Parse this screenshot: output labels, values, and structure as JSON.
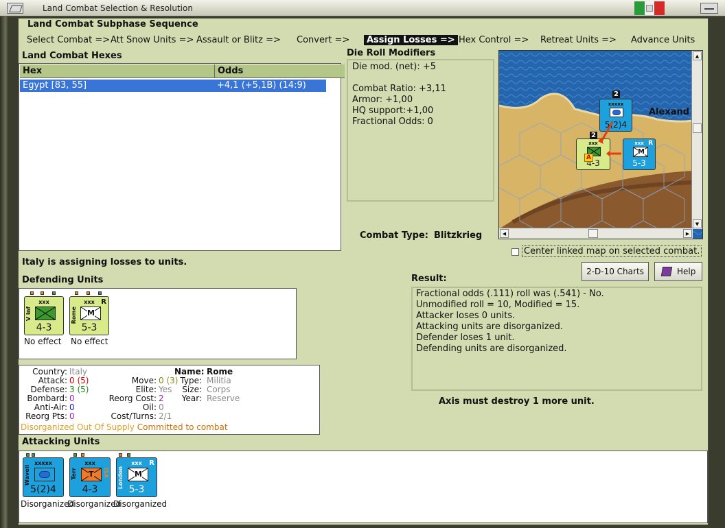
{
  "window": {
    "title": "Land Combat Selection & Resolution"
  },
  "sequence": {
    "header": "Land Combat Subphase Sequence",
    "steps": [
      "Select Combat =>",
      "Att Snow Units =>",
      "Assault or Blitz =>",
      "Convert =>",
      "Assign Losses =>",
      "Hex Control =>",
      "Retreat Units =>",
      "Advance Units"
    ],
    "active_index": 4
  },
  "hexes": {
    "header": "Land Combat Hexes",
    "columns": [
      "Hex",
      "Odds"
    ],
    "rows": [
      {
        "hex": "Egypt [83, 55]",
        "odds": "+4,1 (+5,1B) (14:9)"
      }
    ]
  },
  "modifiers": {
    "header": "Die Roll Modifiers",
    "lines": [
      "Die mod. (net): +5",
      "Combat Ratio: +3,11",
      "Armor: +1,00",
      "HQ support:+1,00",
      "Fractional Odds: 0"
    ]
  },
  "combat_type": {
    "label": "Combat Type:",
    "value": "Blitzkrieg"
  },
  "map": {
    "place_label": "Alexand",
    "center_linked_label": "Center linked map on selected combat.",
    "units": [
      {
        "name": "Wavell",
        "size": "xxxxx",
        "strength": "5(2)4",
        "stack": "2"
      },
      {
        "name": "V Inf",
        "size": "xxx",
        "strength": "4-3",
        "stack": "2",
        "badge": "A"
      },
      {
        "name": "London",
        "size": "xxx",
        "strength": "5-3",
        "type": "M",
        "corner": "R"
      }
    ]
  },
  "status": "Italy is assigning losses to units.",
  "buttons": {
    "charts": "2-D-10 Charts",
    "help": "Help"
  },
  "defending": {
    "header": "Defending Units",
    "units": [
      {
        "name": "V Inf",
        "size": "xxx",
        "strength": "4-3",
        "status": "No effect"
      },
      {
        "name": "Rome",
        "size": "xxx",
        "strength": "5-3",
        "type": "M",
        "corner": "R",
        "status": "No effect"
      }
    ]
  },
  "result": {
    "header": "Result:",
    "lines": [
      "Fractional odds (.111) roll was (.541)  - No.",
      "Unmodified roll = 10, Modified = 15.",
      "Attacker loses 0 units.",
      "Attacking units are disorganized.",
      "Defender loses 1 unit.",
      "Defending units are disorganized."
    ],
    "footer": "Axis must destroy 1 more unit."
  },
  "unit_info": {
    "country_k": "Country:",
    "country_v": "Italy",
    "attack_k": "Attack:",
    "attack_v": "0",
    "attack_p": "(5)",
    "defense_k": "Defense:",
    "defense_v": "3",
    "defense_p": "(5)",
    "bombard_k": "Bombard:",
    "bombard_v": "0",
    "antiair_k": "Anti-Air:",
    "antiair_v": "0",
    "reorg_k": "Reorg Pts:",
    "reorg_v": "0",
    "name_k": "Name:",
    "name_v": "Rome",
    "move_k": "Move:",
    "move_v": "0",
    "move_p": "(3)",
    "type_k": "Type:",
    "type_v": "Militia",
    "elite_k": "Elite:",
    "elite_v": "Yes",
    "size_k": "Size:",
    "size_v": "Corps",
    "reorgcost_k": "Reorg Cost:",
    "reorgcost_v": "2",
    "year_k": "Year:",
    "year_v": "Reserve",
    "oil_k": "Oil:",
    "oil_v": "0",
    "cost_k": "Cost/Turns:",
    "cost_v": "2/1",
    "flag1": "Disorganized",
    "flag2": "Out Of Supply",
    "flag3": "Committed to combat"
  },
  "attacking": {
    "header": "Attacking Units",
    "units": [
      {
        "name": "Wavell",
        "size": "xxxxx",
        "strength": "5(2)4",
        "status": "Disorganized"
      },
      {
        "name": "Terr",
        "size": "xxx",
        "strength": "4-3",
        "type": "T",
        "side": "ISA",
        "status": "Disorganized"
      },
      {
        "name": "London",
        "size": "xxx",
        "strength": "5-3",
        "type": "M",
        "corner": "R",
        "status": "Disorganized"
      }
    ]
  },
  "colors": {
    "panel": "#d2dcb0",
    "selection": "#3875d7",
    "italy_unit": "#d8ea8a",
    "uk_unit": "#1ea0dc",
    "sea": "#1f5fa8",
    "desert": "#d8b566"
  }
}
